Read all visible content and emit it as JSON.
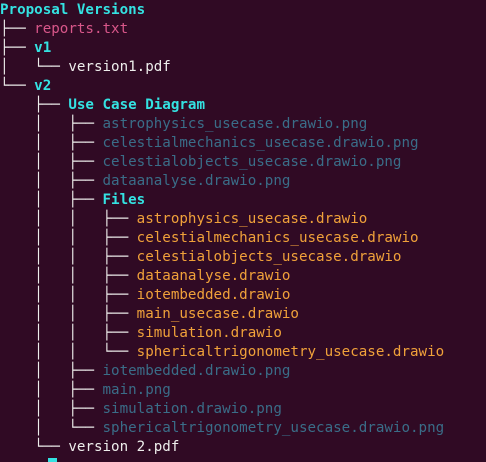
{
  "colors": {
    "background": "#300a24",
    "directory": "#34e2e2",
    "default_text": "#eeeeec",
    "txt_file": "#d9578a",
    "png_file": "#3a6d88",
    "drawio_file": "#f0a13a"
  },
  "tree": [
    {
      "prefix": "",
      "name": "Proposal Versions",
      "kind": "dir"
    },
    {
      "prefix": "├── ",
      "name": "reports.txt",
      "kind": "txt"
    },
    {
      "prefix": "├── ",
      "name": "v1",
      "kind": "dir"
    },
    {
      "prefix": "│   └── ",
      "name": "version1.pdf",
      "kind": "pdf"
    },
    {
      "prefix": "└── ",
      "name": "v2",
      "kind": "dir"
    },
    {
      "prefix": "    ├── ",
      "name": "Use Case Diagram",
      "kind": "dir"
    },
    {
      "prefix": "    │   ├── ",
      "name": "astrophysics_usecase.drawio.png",
      "kind": "png"
    },
    {
      "prefix": "    │   ├── ",
      "name": "celestialmechanics_usecase.drawio.png",
      "kind": "png"
    },
    {
      "prefix": "    │   ├── ",
      "name": "celestialobjects_usecase.drawio.png",
      "kind": "png"
    },
    {
      "prefix": "    │   ├── ",
      "name": "dataanalyse.drawio.png",
      "kind": "png"
    },
    {
      "prefix": "    │   ├── ",
      "name": "Files",
      "kind": "dir"
    },
    {
      "prefix": "    │   │   ├── ",
      "name": "astrophysics_usecase.drawio",
      "kind": "drawio"
    },
    {
      "prefix": "    │   │   ├── ",
      "name": "celestialmechanics_usecase.drawio",
      "kind": "drawio"
    },
    {
      "prefix": "    │   │   ├── ",
      "name": "celestialobjects_usecase.drawio",
      "kind": "drawio"
    },
    {
      "prefix": "    │   │   ├── ",
      "name": "dataanalyse.drawio",
      "kind": "drawio"
    },
    {
      "prefix": "    │   │   ├── ",
      "name": "iotembedded.drawio",
      "kind": "drawio"
    },
    {
      "prefix": "    │   │   ├── ",
      "name": "main_usecase.drawio",
      "kind": "drawio"
    },
    {
      "prefix": "    │   │   ├── ",
      "name": "simulation.drawio",
      "kind": "drawio"
    },
    {
      "prefix": "    │   │   └── ",
      "name": "sphericaltrigonometry_usecase.drawio",
      "kind": "drawio"
    },
    {
      "prefix": "    │   ├── ",
      "name": "iotembedded.drawio.png",
      "kind": "png"
    },
    {
      "prefix": "    │   ├── ",
      "name": "main.png",
      "kind": "png"
    },
    {
      "prefix": "    │   ├── ",
      "name": "simulation.drawio.png",
      "kind": "png"
    },
    {
      "prefix": "    │   └── ",
      "name": "sphericaltrigonometry_usecase.drawio.png",
      "kind": "png"
    },
    {
      "prefix": "    └── ",
      "name": "version 2.pdf",
      "kind": "pdf"
    }
  ]
}
